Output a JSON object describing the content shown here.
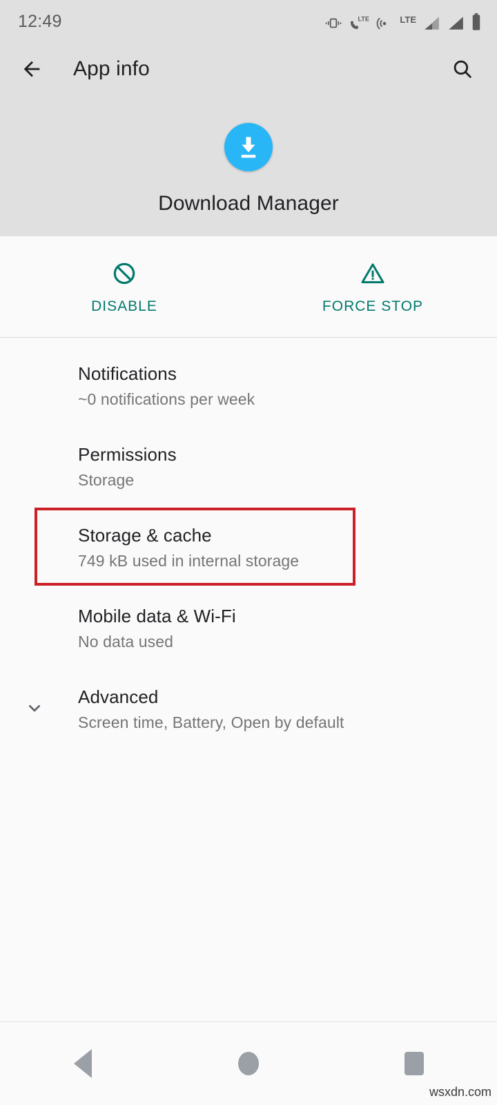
{
  "statusbar": {
    "time": "12:49",
    "icons": [
      {
        "name": "vibrate-icon"
      },
      {
        "name": "volte-phone-icon"
      },
      {
        "name": "hotspot-icon"
      },
      {
        "name": "lte-label-icon",
        "text": "LTE"
      },
      {
        "name": "signal-bar-1-icon"
      },
      {
        "name": "signal-bar-2-icon"
      },
      {
        "name": "battery-icon"
      }
    ]
  },
  "appbar": {
    "back_label": "back-arrow",
    "title": "App info",
    "search_label": "search"
  },
  "app_header": {
    "icon_name": "download-manager-app-icon",
    "icon_color": "#29b6f6",
    "app_name": "Download Manager"
  },
  "actions": {
    "accent_color": "#00796b",
    "items": [
      {
        "icon": "disable-block-icon",
        "label": "DISABLE"
      },
      {
        "icon": "warning-triangle-icon",
        "label": "FORCE STOP"
      }
    ]
  },
  "list": {
    "rows": [
      {
        "name": "notifications",
        "title": "Notifications",
        "subtitle": "~0 notifications per week",
        "has_chevron": false,
        "highlighted": false
      },
      {
        "name": "permissions",
        "title": "Permissions",
        "subtitle": "Storage",
        "has_chevron": false,
        "highlighted": false
      },
      {
        "name": "storage-and-cache",
        "title": "Storage & cache",
        "subtitle": "749 kB used in internal storage",
        "has_chevron": false,
        "highlighted": true
      },
      {
        "name": "mobile-data-and-wifi",
        "title": "Mobile data & Wi-Fi",
        "subtitle": "No data used",
        "has_chevron": false,
        "highlighted": false
      },
      {
        "name": "advanced",
        "title": "Advanced",
        "subtitle": "Screen time, Battery, Open by default",
        "has_chevron": true,
        "highlighted": false
      }
    ]
  },
  "highlight": {
    "color": "#cc2029"
  },
  "navbar": {
    "buttons": [
      {
        "name": "nav-back-button"
      },
      {
        "name": "nav-home-button"
      },
      {
        "name": "nav-recents-button"
      }
    ]
  },
  "watermark": {
    "text": "wsxdn.com"
  }
}
